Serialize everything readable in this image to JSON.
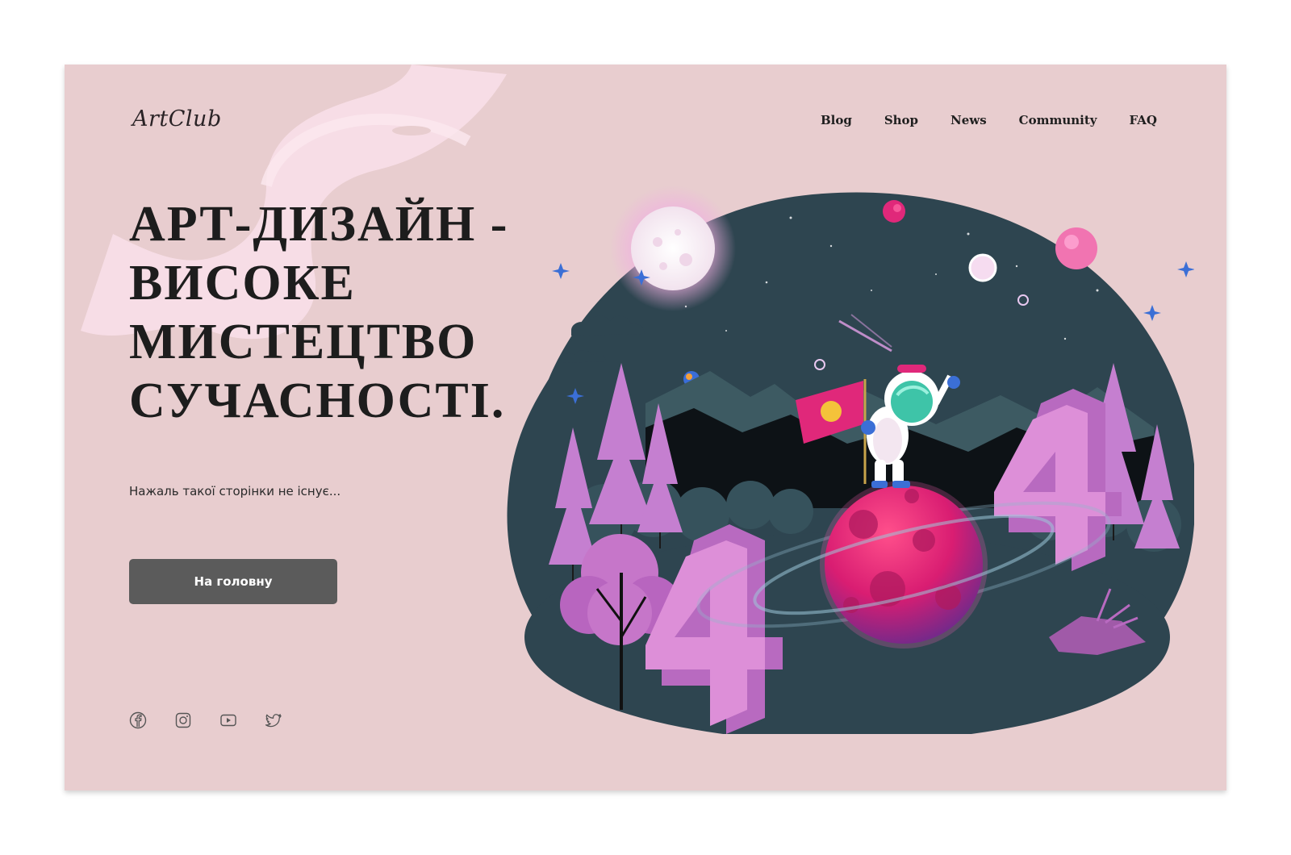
{
  "brand": {
    "logo_text": "ArtClub"
  },
  "nav": {
    "items": [
      {
        "label": "Blog"
      },
      {
        "label": "Shop"
      },
      {
        "label": "News"
      },
      {
        "label": "Community"
      },
      {
        "label": "FAQ"
      }
    ]
  },
  "hero": {
    "headline_lines": [
      "АРТ-ДИЗАЙН -",
      "ВИСОКЕ",
      "МИСТЕЦТВО",
      "СУЧАСНОСТІ."
    ],
    "subtitle": "Нажаль такої сторінки не існує...",
    "button_label": "На головну"
  },
  "socials": [
    {
      "icon": "facebook-icon"
    },
    {
      "icon": "instagram-icon"
    },
    {
      "icon": "youtube-icon"
    },
    {
      "icon": "twitter-icon"
    }
  ],
  "colors": {
    "background": "#e8cdcf",
    "button": "#5b5b5b",
    "scene_dark": "#2e4550",
    "accent_pink": "#d98ad8",
    "planet_magenta": "#e0287a"
  }
}
